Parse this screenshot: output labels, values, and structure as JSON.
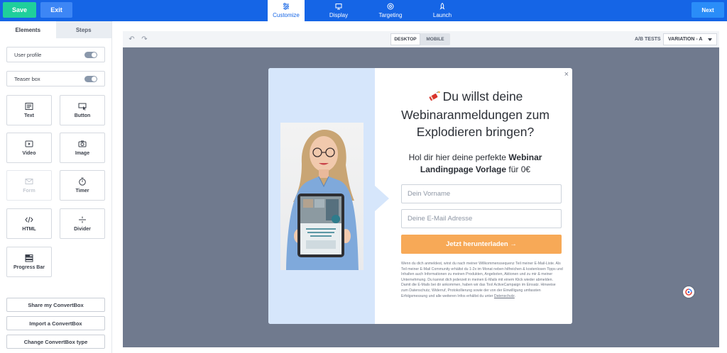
{
  "topbar": {
    "save_label": "Save",
    "exit_label": "Exit",
    "next_label": "Next",
    "tabs": [
      {
        "label": "Customize",
        "icon": "sliders-icon",
        "active": true
      },
      {
        "label": "Display",
        "icon": "monitor-icon",
        "active": false
      },
      {
        "label": "Targeting",
        "icon": "target-icon",
        "active": false
      },
      {
        "label": "Launch",
        "icon": "rocket-icon",
        "active": false
      }
    ]
  },
  "sidebar": {
    "tabs": [
      {
        "label": "Elements",
        "active": true
      },
      {
        "label": "Steps",
        "active": false
      }
    ],
    "toggles": [
      {
        "label": "User profile",
        "on": true
      },
      {
        "label": "Teaser box",
        "on": true
      }
    ],
    "elements": [
      {
        "label": "Text",
        "icon": "text-icon"
      },
      {
        "label": "Button",
        "icon": "button-cursor-icon"
      },
      {
        "label": "Video",
        "icon": "video-play-icon"
      },
      {
        "label": "Image",
        "icon": "camera-icon"
      },
      {
        "label": "Form",
        "icon": "envelope-icon",
        "disabled": true
      },
      {
        "label": "Timer",
        "icon": "stopwatch-icon"
      },
      {
        "label": "HTML",
        "icon": "code-icon"
      },
      {
        "label": "Divider",
        "icon": "divider-icon"
      },
      {
        "label": "Progress Bar",
        "icon": "progress-bar-icon"
      }
    ],
    "buttons": [
      {
        "label": "Share my ConvertBox"
      },
      {
        "label": "Import a ConvertBox"
      },
      {
        "label": "Change ConvertBox type"
      }
    ]
  },
  "canvas": {
    "devices": [
      {
        "label": "DESKTOP",
        "active": true
      },
      {
        "label": "MOBILE",
        "active": false
      }
    ],
    "ab_label": "A/B TESTS",
    "variation": "VARIATION - A"
  },
  "popup": {
    "close": "×",
    "headline": "Du willst deine Webinaranmeldungen zum Explodieren bringen?",
    "sub_prefix": "Hol dir hier deine perfekte ",
    "sub_bold": "Webinar Landingpage Vorlage",
    "sub_suffix": " für 0€",
    "first_name_placeholder": "Dein Vorname",
    "email_placeholder": "Deine E-Mail Adresse",
    "cta_label": "Jetzt herunterladen →",
    "fine_print": "Wenn du dich anmeldest, wirst du nach meiner Willkommenssequenz Teil meiner E-Mail-Liste. Als Teil meiner E-Mail Community erhältst du 1-2x im Monat neben hilfreichen & kostenlosen Tipps und Inhalten auch Informationen zu meinen Produkten, Angeboten, Aktionen und zu mir & meiner Unternehmung. Du kannst dich jederzeit in meinen E-Mails mit einem Klick wieder abmelden. Damit die E-Mails bei dir ankommen, haben wir das Tool ActiveCampaign im Einsatz. Hinweise zum Datenschutz, Widerruf, Protokollierung sowie der von der Einwilligung umfassten Erfolgsmessung und alle weiteren Infos erhältst du unter ",
    "fine_link": "Datenschutz",
    "fine_end": ".",
    "tablet_text": "DIE PERFEKTE LANDINGPAGE FÜR DEIN WEBINAR"
  }
}
